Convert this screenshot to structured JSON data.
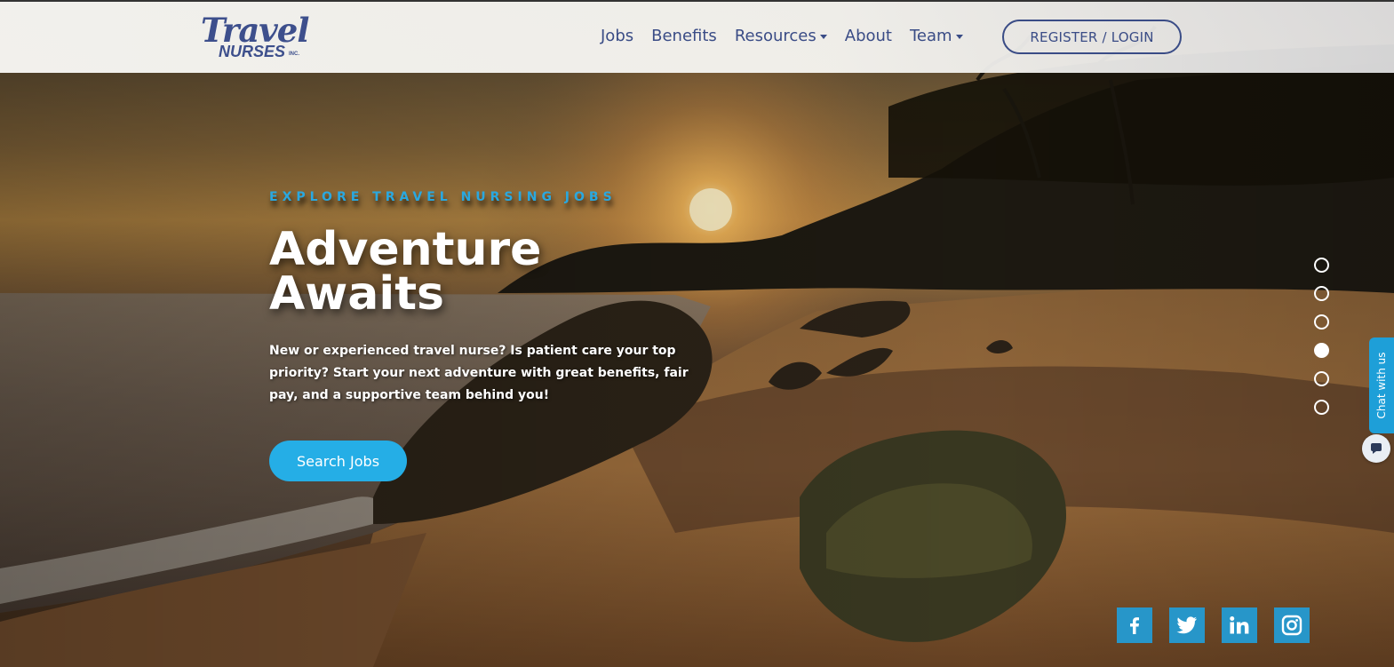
{
  "brand": {
    "logo_line1": "Travel",
    "logo_line2": "NURSES",
    "logo_suffix": "INC.",
    "color": "#3d4f8c"
  },
  "nav": {
    "items": [
      {
        "label": "Jobs",
        "dropdown": false
      },
      {
        "label": "Benefits",
        "dropdown": false
      },
      {
        "label": "Resources",
        "dropdown": true
      },
      {
        "label": "About",
        "dropdown": false
      },
      {
        "label": "Team",
        "dropdown": true
      }
    ],
    "register_label": "REGISTER / LOGIN"
  },
  "hero": {
    "eyebrow": "EXPLORE TRAVEL NURSING JOBS",
    "headline_line1": "Adventure",
    "headline_line2": "Awaits",
    "intro": "New or experienced travel nurse? Is patient care your top priority? Start your next adventure with great benefits, fair pay, and a supportive team behind you!",
    "cta_label": "Search Jobs",
    "accent_color": "#25aee6"
  },
  "slider": {
    "slide_count": 6,
    "active_index": 3
  },
  "chat": {
    "label": "Chat with us"
  },
  "social": [
    {
      "name": "facebook-icon",
      "glyph": "f"
    },
    {
      "name": "twitter-icon",
      "glyph": ""
    },
    {
      "name": "linkedin-icon",
      "glyph": "in"
    },
    {
      "name": "instagram-icon",
      "glyph": ""
    }
  ]
}
